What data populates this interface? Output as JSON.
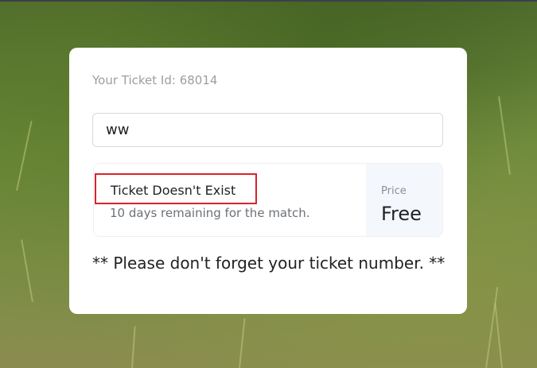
{
  "ticket": {
    "id_label": "Your Ticket Id: 68014",
    "input_value": "ww"
  },
  "status": {
    "title": "Ticket Doesn't Exist",
    "subtitle": "10 days remaining for the match."
  },
  "price": {
    "label": "Price",
    "value": "Free"
  },
  "note": "** Please don't forget your ticket number. **",
  "colors": {
    "error_border": "#d9232b",
    "card_background": "#ffffff",
    "price_panel": "#f4f7fb"
  }
}
